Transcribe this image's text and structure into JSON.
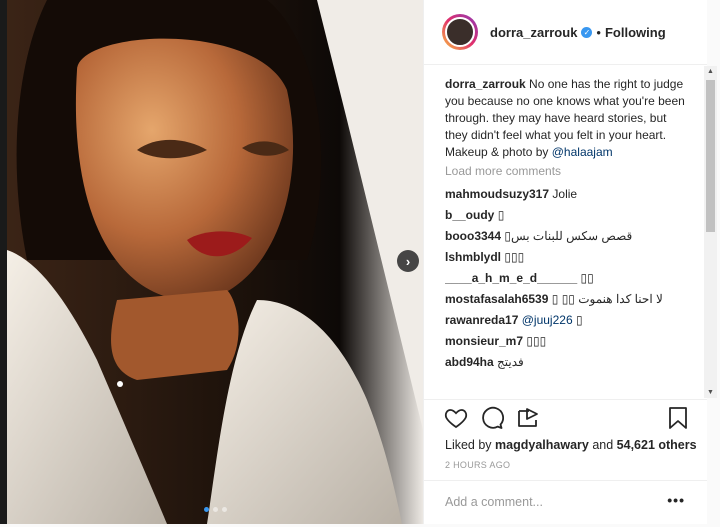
{
  "post": {
    "username": "dorra_zarrouk",
    "follow_status": "Following",
    "separator": "•",
    "caption": {
      "username": "dorra_zarrouk",
      "text": "No one has the right to judge you because no one knows what you're been through. they may have heard stories, but they didn't feel what you felt in your heart.",
      "credit_prefix": "Makeup & photo by",
      "credit_mention": "@halaajam"
    },
    "load_more": "Load more comments",
    "comments": [
      {
        "user": "mahmoudsuzy317",
        "text": "Jolie"
      },
      {
        "user": "b__oudy",
        "text": "▯"
      },
      {
        "user": "booo3344",
        "text": "قصص سكس للبنات بس▯"
      },
      {
        "user": "lshmblydl",
        "text": "▯▯▯"
      },
      {
        "user": "____a_h_m_e_d______",
        "text": "▯▯"
      },
      {
        "user": "mostafasalah6539",
        "text": "لا احنا كدا هنموت ▯▯ ▯"
      },
      {
        "user": "rawanreda17",
        "mention": "@juuj226",
        "text": "▯"
      },
      {
        "user": "monsieur_m7",
        "text": "▯▯▯"
      },
      {
        "user": "abd94ha",
        "text": "فديتج"
      }
    ],
    "likes": {
      "prefix": "Liked by",
      "user": "magdyalhawary",
      "and": "and",
      "count": "54,621 others"
    },
    "timestamp": "2 HOURS AGO",
    "add_comment_placeholder": "Add a comment...",
    "more_options": "•••",
    "next_arrow": "›"
  },
  "colors": {
    "accent": "#3897f0",
    "text": "#262626",
    "muted": "#999999",
    "mention": "#003569"
  },
  "icons": [
    "verified-badge-icon",
    "next-arrow-icon",
    "heart-icon",
    "comment-icon",
    "share-icon",
    "bookmark-icon",
    "heart-small-icon",
    "more-options-icon"
  ]
}
